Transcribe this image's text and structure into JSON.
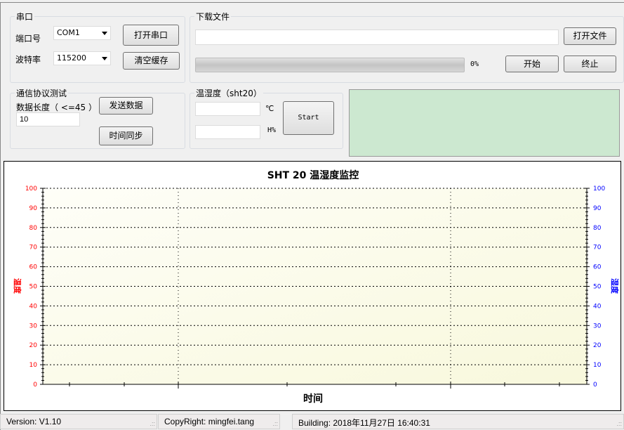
{
  "serial": {
    "title": "串口",
    "port_label": "端口号",
    "port_value": "COM1",
    "baud_label": "波特率",
    "baud_value": "115200",
    "open_button": "打开串口",
    "clear_button": "清空缓存"
  },
  "download": {
    "title": "下载文件",
    "file_path": "",
    "open_file_button": "打开文件",
    "progress_percent": 0,
    "progress_text": "0%",
    "start_button": "开始",
    "stop_button": "终止"
  },
  "protocol": {
    "title": "通信协议测试",
    "length_label": "数据长度（ <=45 ）",
    "length_value": "10",
    "send_button": "发送数据",
    "sync_button": "时间同步"
  },
  "sht": {
    "title": "温湿度（sht20）",
    "temp_value": "",
    "temp_unit": "℃",
    "hum_value": "",
    "hum_unit": "H%",
    "start_button": "Start"
  },
  "indicator_color": "#cce8d0",
  "chart_data": {
    "type": "line",
    "title": "SHT 20 温湿度监控",
    "xlabel": "时间",
    "ylabel_left": "温度",
    "ylabel_right": "湿度",
    "ylim_left": [
      0,
      100
    ],
    "ylim_right": [
      0,
      100
    ],
    "yticks": [
      0,
      10,
      20,
      30,
      40,
      50,
      60,
      70,
      80,
      90,
      100
    ],
    "grid": true,
    "series": [],
    "left_color": "#ff0000",
    "right_color": "#0000ff"
  },
  "status": {
    "version": "Version: V1.10",
    "copyright": "CopyRight: mingfei.tang",
    "building": "Building: 2018年11月27日 16:40:31"
  }
}
